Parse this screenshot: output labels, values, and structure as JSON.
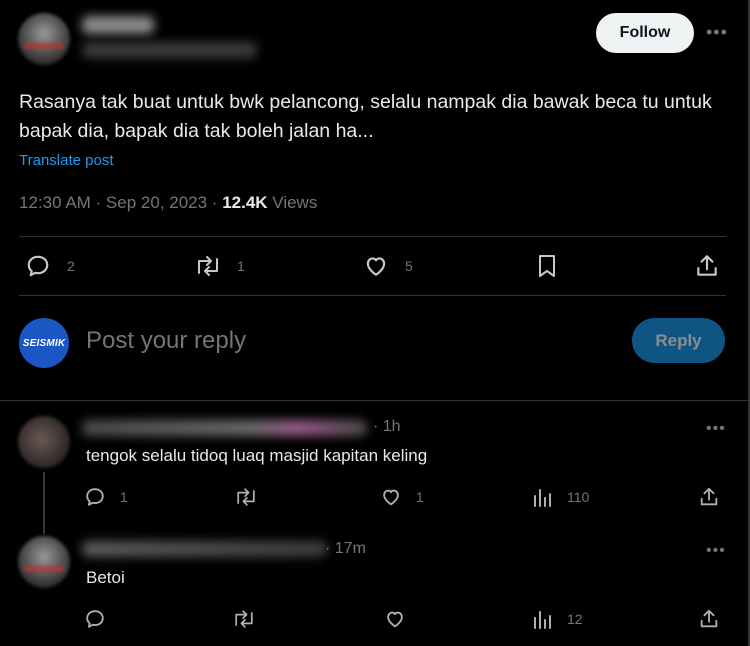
{
  "post": {
    "text": "Rasanya tak buat untuk bwk pelancong, selalu nampak dia bawak beca tu untuk bapak dia, bapak dia tak boleh jalan ha...",
    "translate_label": "Translate post",
    "timestamp": "12:30 AM · Sep 20, 2023 · ",
    "views_count": "12.4K",
    "views_label": " Views",
    "follow_label": "Follow",
    "replies": "2",
    "reposts": "1",
    "likes": "5"
  },
  "composer": {
    "avatar_text": "SEISMIK",
    "placeholder": "Post your reply",
    "reply_label": "Reply"
  },
  "replies": [
    {
      "time": "· 1h",
      "text": "tengok selalu tidoq luaq masjid kapitan keling",
      "replies": "1",
      "reposts": "",
      "likes": "1",
      "views": "110"
    },
    {
      "time": "· 17m",
      "text": "Betoi",
      "replies": "",
      "reposts": "",
      "likes": "",
      "views": "12"
    }
  ],
  "colors": {
    "background": "#000000",
    "text": "#e7e9ea",
    "muted": "#71767b",
    "accent": "#1d9bf0",
    "divider": "#2f3336",
    "seismik_blue": "#1a56c4"
  }
}
